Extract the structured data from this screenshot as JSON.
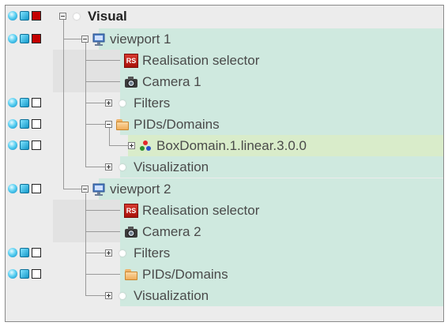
{
  "tree": {
    "root": {
      "label": "Visual"
    },
    "viewport1": {
      "label": "viewport 1",
      "children": {
        "realisation": "Realisation selector",
        "camera": "Camera 1",
        "filters": "Filters",
        "pids": "PIDs/Domains",
        "domain": "BoxDomain.1.linear.3.0.0",
        "visualization": "Visualization"
      }
    },
    "viewport2": {
      "label": "viewport 2",
      "children": {
        "realisation": "Realisation selector",
        "camera": "Camera 2",
        "filters": "Filters",
        "pids": "PIDs/Domains",
        "visualization": "Visualization"
      }
    },
    "rs_badge": "RS"
  },
  "colors": {
    "row_green": "#cfe9df",
    "row_highlight": "#d9ecca",
    "panel_bg": "#ececec",
    "selected_red": "#c40000"
  },
  "icons": {
    "visibility": "sphere-icon",
    "render3d": "cube-icon",
    "select": "checkbox-icon",
    "viewport": "monitor-icon",
    "realisation": "rs-icon",
    "camera": "camera-icon",
    "folder": "folder-icon",
    "domain": "rgb-triangle-icon",
    "empty": "dot-icon"
  }
}
